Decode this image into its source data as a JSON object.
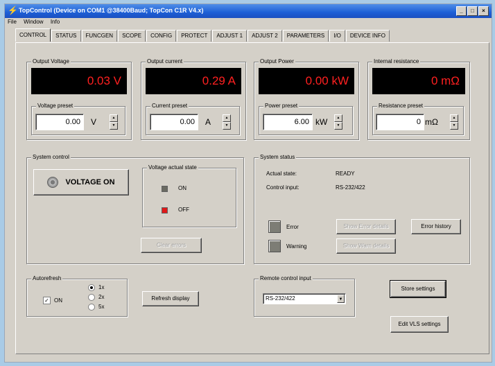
{
  "window": {
    "title": "TopControl (Device on COM1 @38400Baud; TopCon C1R V4.x)",
    "buttons": [
      "_",
      "□",
      "×"
    ]
  },
  "menu": [
    "File",
    "Window",
    "Info"
  ],
  "tabs": [
    "CONTROL",
    "STATUS",
    "FUNCGEN",
    "SCOPE",
    "CONFIG",
    "PROTECT",
    "ADJUST 1",
    "ADJUST 2",
    "PARAMETERS",
    "I/O",
    "DEVICE INFO"
  ],
  "meters": [
    {
      "label": "Output Voltage",
      "value": "0.03 V",
      "preset_label": "Voltage preset",
      "preset_value": "0.00",
      "unit": "V"
    },
    {
      "label": "Output current",
      "value": "0.29 A",
      "preset_label": "Current preset",
      "preset_value": "0.00",
      "unit": "A"
    },
    {
      "label": "Output Power",
      "value": "0.00 kW",
      "preset_label": "Power preset",
      "preset_value": "6.00",
      "unit": "kW"
    },
    {
      "label": "Internal resistance",
      "value": "0 mΩ",
      "preset_label": "Resistance preset",
      "preset_value": "0",
      "unit": "mΩ"
    }
  ],
  "system_control": {
    "label": "System control",
    "voltage_button": "VOLTAGE ON",
    "actual_state_label": "Voltage actual state",
    "on_label": "ON",
    "off_label": "OFF",
    "clear_errors": "Clear errors",
    "colors": {
      "on_led": "#6a6a62",
      "off_led": "#e01818"
    }
  },
  "system_status": {
    "label": "System status",
    "actual_state_label": "Actual state:",
    "actual_state_value": "READY",
    "control_input_label": "Control input:",
    "control_input_value": "RS-232/422",
    "error_label": "Error",
    "warning_label": "Warning",
    "show_error_details": "Show Error details",
    "show_warning_details": "Show Warn details",
    "error_history": "Error history"
  },
  "autorefresh": {
    "label": "Autorefresh",
    "on_label": "ON",
    "on_checked": true,
    "options": [
      "1x",
      "2x",
      "5x"
    ],
    "selected": "1x"
  },
  "refresh_display": "Refresh display",
  "remote_control": {
    "label": "Remote control input",
    "value": "RS-232/422"
  },
  "store_settings": "Store settings",
  "edit_vls": "Edit VLS settings"
}
